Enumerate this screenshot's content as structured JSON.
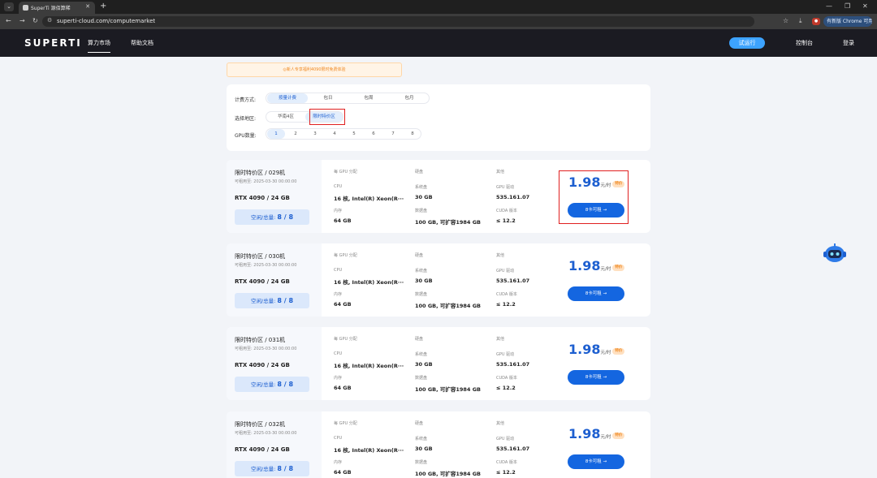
{
  "browser": {
    "tab_title": "SuperTi 源佰算稀",
    "url": "superti-cloud.com/computemarket",
    "profile_label": "有新版 Chrome 可用"
  },
  "site": {
    "logo": "SUPERTI",
    "menu": [
      "算力市场",
      "帮助文档"
    ],
    "trial_button": "试运行",
    "console_link": "控制台",
    "login_link": "登录"
  },
  "notice": "◎新人专享福利4090限时免费体验",
  "filters": {
    "billing_label": "计费方式:",
    "billing_options": [
      "按量计费",
      "包日",
      "包周",
      "包月"
    ],
    "region_label": "选择地区:",
    "region_options": [
      "华南4区",
      "限时特价区"
    ],
    "gpu_label": "GPU数量:",
    "gpu_options": [
      "1",
      "2",
      "3",
      "4",
      "5",
      "6",
      "7",
      "8"
    ]
  },
  "card_labels": {
    "per_gpu": "每 GPU 分配",
    "cpu": "CPU",
    "memory": "内存",
    "disk": "硬盘",
    "system_disk": "系统盘",
    "data_disk": "数据盘",
    "other": "其他",
    "gpu_driver": "GPU 驱动",
    "cuda": "CUDA 版本",
    "unit": "元/时",
    "tag": "特价",
    "rent_button": "8卡可租 →",
    "free_label": "空闲/总量:"
  },
  "cards": [
    {
      "title": "限时特价区 / 029机",
      "date": "可租用至: 2025-03-30 00:00:00",
      "gpu": "RTX 4090 / 24 GB",
      "free": "8 / 8",
      "cpu": "16 核, Intel(R) Xeon(R···",
      "memory": "64 GB",
      "system_disk": "30 GB",
      "data_disk": "100 GB, 可扩容1984 GB",
      "driver": "535.161.07",
      "cuda": "≤ 12.2",
      "price": "1.98"
    },
    {
      "title": "限时特价区 / 030机",
      "date": "可租用至: 2025-03-30 00:00:00",
      "gpu": "RTX 4090 / 24 GB",
      "free": "8 / 8",
      "cpu": "16 核, Intel(R) Xeon(R···",
      "memory": "64 GB",
      "system_disk": "30 GB",
      "data_disk": "100 GB, 可扩容1984 GB",
      "driver": "535.161.07",
      "cuda": "≤ 12.2",
      "price": "1.98"
    },
    {
      "title": "限时特价区 / 031机",
      "date": "可租用至: 2025-03-30 00:00:00",
      "gpu": "RTX 4090 / 24 GB",
      "free": "8 / 8",
      "cpu": "16 核, Intel(R) Xeon(R···",
      "memory": "64 GB",
      "system_disk": "30 GB",
      "data_disk": "100 GB, 可扩容1984 GB",
      "driver": "535.161.07",
      "cuda": "≤ 12.2",
      "price": "1.98"
    },
    {
      "title": "限时特价区 / 032机",
      "date": "可租用至: 2025-03-30 00:00:00",
      "gpu": "RTX 4090 / 24 GB",
      "free": "8 / 8",
      "cpu": "16 核, Intel(R) Xeon(R···",
      "memory": "64 GB",
      "system_disk": "30 GB",
      "data_disk": "100 GB, 可扩容1984 GB",
      "driver": "535.161.07",
      "cuda": "≤ 12.2",
      "price": "1.98"
    }
  ],
  "colors": {
    "accent": "#1466e0",
    "price": "#1d5fd0",
    "highlight": "#e02020",
    "header": "#1b1b22"
  }
}
